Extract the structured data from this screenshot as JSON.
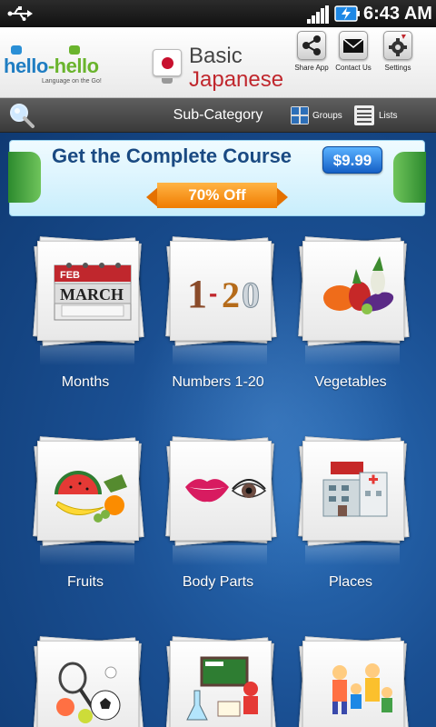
{
  "status_bar": {
    "time": "6:43 AM",
    "icons": [
      "usb-icon",
      "signal-icon",
      "battery-charging-icon"
    ]
  },
  "header": {
    "logo": {
      "brand_part1": "hello",
      "brand_hyphen": "-",
      "brand_part2": "hello",
      "tagline": "Language on the Go!"
    },
    "course": {
      "line1": "Basic",
      "line2": "Japanese",
      "icon": "japan-flag-icon"
    },
    "buttons": [
      {
        "label": "Share App",
        "icon": "share-icon"
      },
      {
        "label": "Contact Us",
        "icon": "envelope-icon"
      },
      {
        "label": "Settings",
        "icon": "settings-icon"
      }
    ]
  },
  "toolbar": {
    "title": "Sub-Category",
    "groups_label": "Groups",
    "lists_label": "Lists",
    "search_icon": "magnifier-icon"
  },
  "banner": {
    "headline": "Get the Complete Course",
    "price": "$9.99",
    "discount": "70% Off",
    "colors": {
      "price_bg": "#1f74d8",
      "discount_bg": "#f59200",
      "headline": "#1a4a82"
    }
  },
  "categories": [
    {
      "label": "Months",
      "icon": "calendar-icon",
      "calendar": {
        "month_top": "FEB",
        "month_main": "MARCH"
      }
    },
    {
      "label": "Numbers 1-20",
      "icon": "numbers-icon",
      "numbers": {
        "d1": "1",
        "dash": "-",
        "d2": "2",
        "d3": "0"
      }
    },
    {
      "label": "Vegetables",
      "icon": "vegetables-icon"
    },
    {
      "label": "Fruits",
      "icon": "fruits-icon"
    },
    {
      "label": "Body Parts",
      "icon": "lips-eye-icon"
    },
    {
      "label": "Places",
      "icon": "buildings-icon"
    },
    {
      "label": "",
      "icon": "sports-balls-icon"
    },
    {
      "label": "",
      "icon": "science-news-icon"
    },
    {
      "label": "",
      "icon": "family-icon"
    }
  ]
}
